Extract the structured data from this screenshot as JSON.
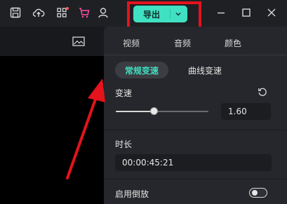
{
  "titlebar": {
    "icons": [
      "save-icon",
      "cloud-upload-icon",
      "apps-grid-icon",
      "cart-icon",
      "user-icon"
    ],
    "export_label": "导出",
    "export_arrow": "chevron-down-icon",
    "window_controls": [
      "minimize-icon",
      "maximize-icon",
      "close-icon"
    ],
    "accent": "#3fe1c2",
    "cart_color": "#ff4fa3",
    "highlight_color": "#e4131c"
  },
  "left": {
    "icon": "image-icon"
  },
  "panel": {
    "tabs": [
      {
        "label": "视频"
      },
      {
        "label": "音频"
      },
      {
        "label": "颜色"
      }
    ],
    "segments": {
      "active": "常规变速",
      "other": "曲线变速"
    },
    "speed": {
      "label": "变速",
      "value": "1.60",
      "level": 0.41
    },
    "duration": {
      "label": "时长",
      "value": "00:00:45:21"
    },
    "reverse": {
      "label": "启用倒放",
      "enabled": false
    }
  }
}
